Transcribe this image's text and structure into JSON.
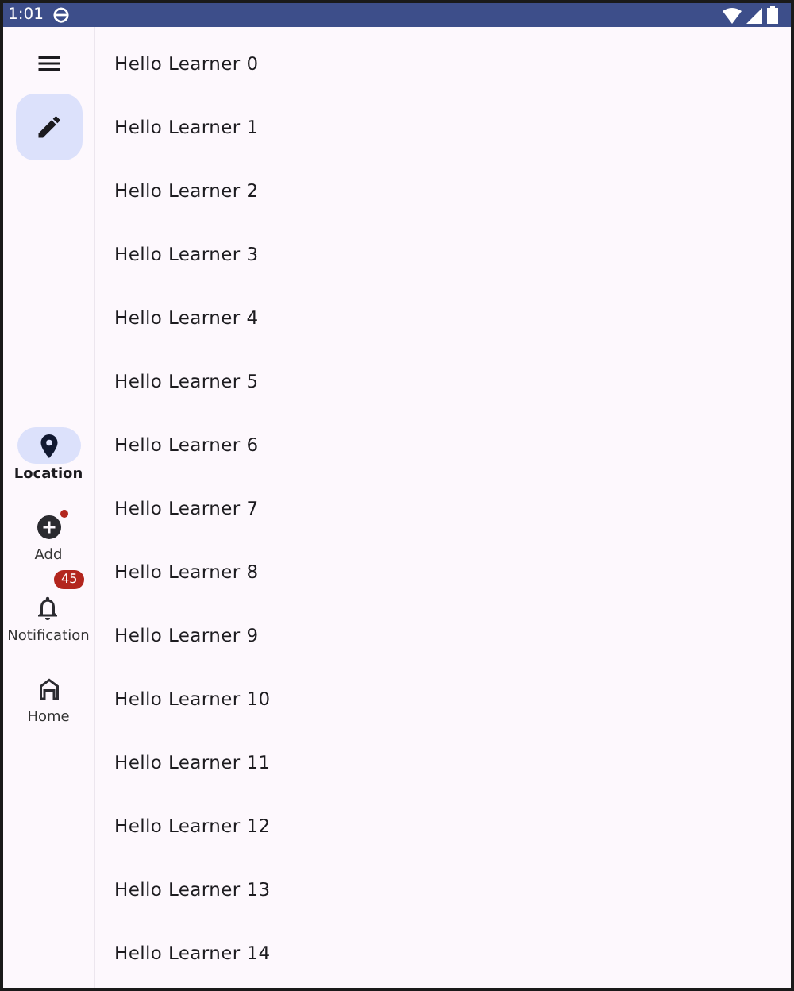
{
  "status_bar": {
    "time": "1:01"
  },
  "rail": {
    "fab": {
      "kind": "edit"
    },
    "items": [
      {
        "label": "Location",
        "kind": "pin",
        "selected": true,
        "dot": false
      },
      {
        "label": "Add",
        "kind": "add",
        "selected": false,
        "dot": true
      },
      {
        "label": "Notification",
        "kind": "bell",
        "selected": false,
        "dot": false,
        "count": "45"
      },
      {
        "label": "Home",
        "kind": "home",
        "selected": false,
        "dot": false
      }
    ]
  },
  "list": [
    "Hello Learner 0",
    "Hello Learner 1",
    "Hello Learner 2",
    "Hello Learner 3",
    "Hello Learner 4",
    "Hello Learner 5",
    "Hello Learner 6",
    "Hello Learner 7",
    "Hello Learner 8",
    "Hello Learner 9",
    "Hello Learner 10",
    "Hello Learner 11",
    "Hello Learner 12",
    "Hello Learner 13",
    "Hello Learner 14"
  ]
}
